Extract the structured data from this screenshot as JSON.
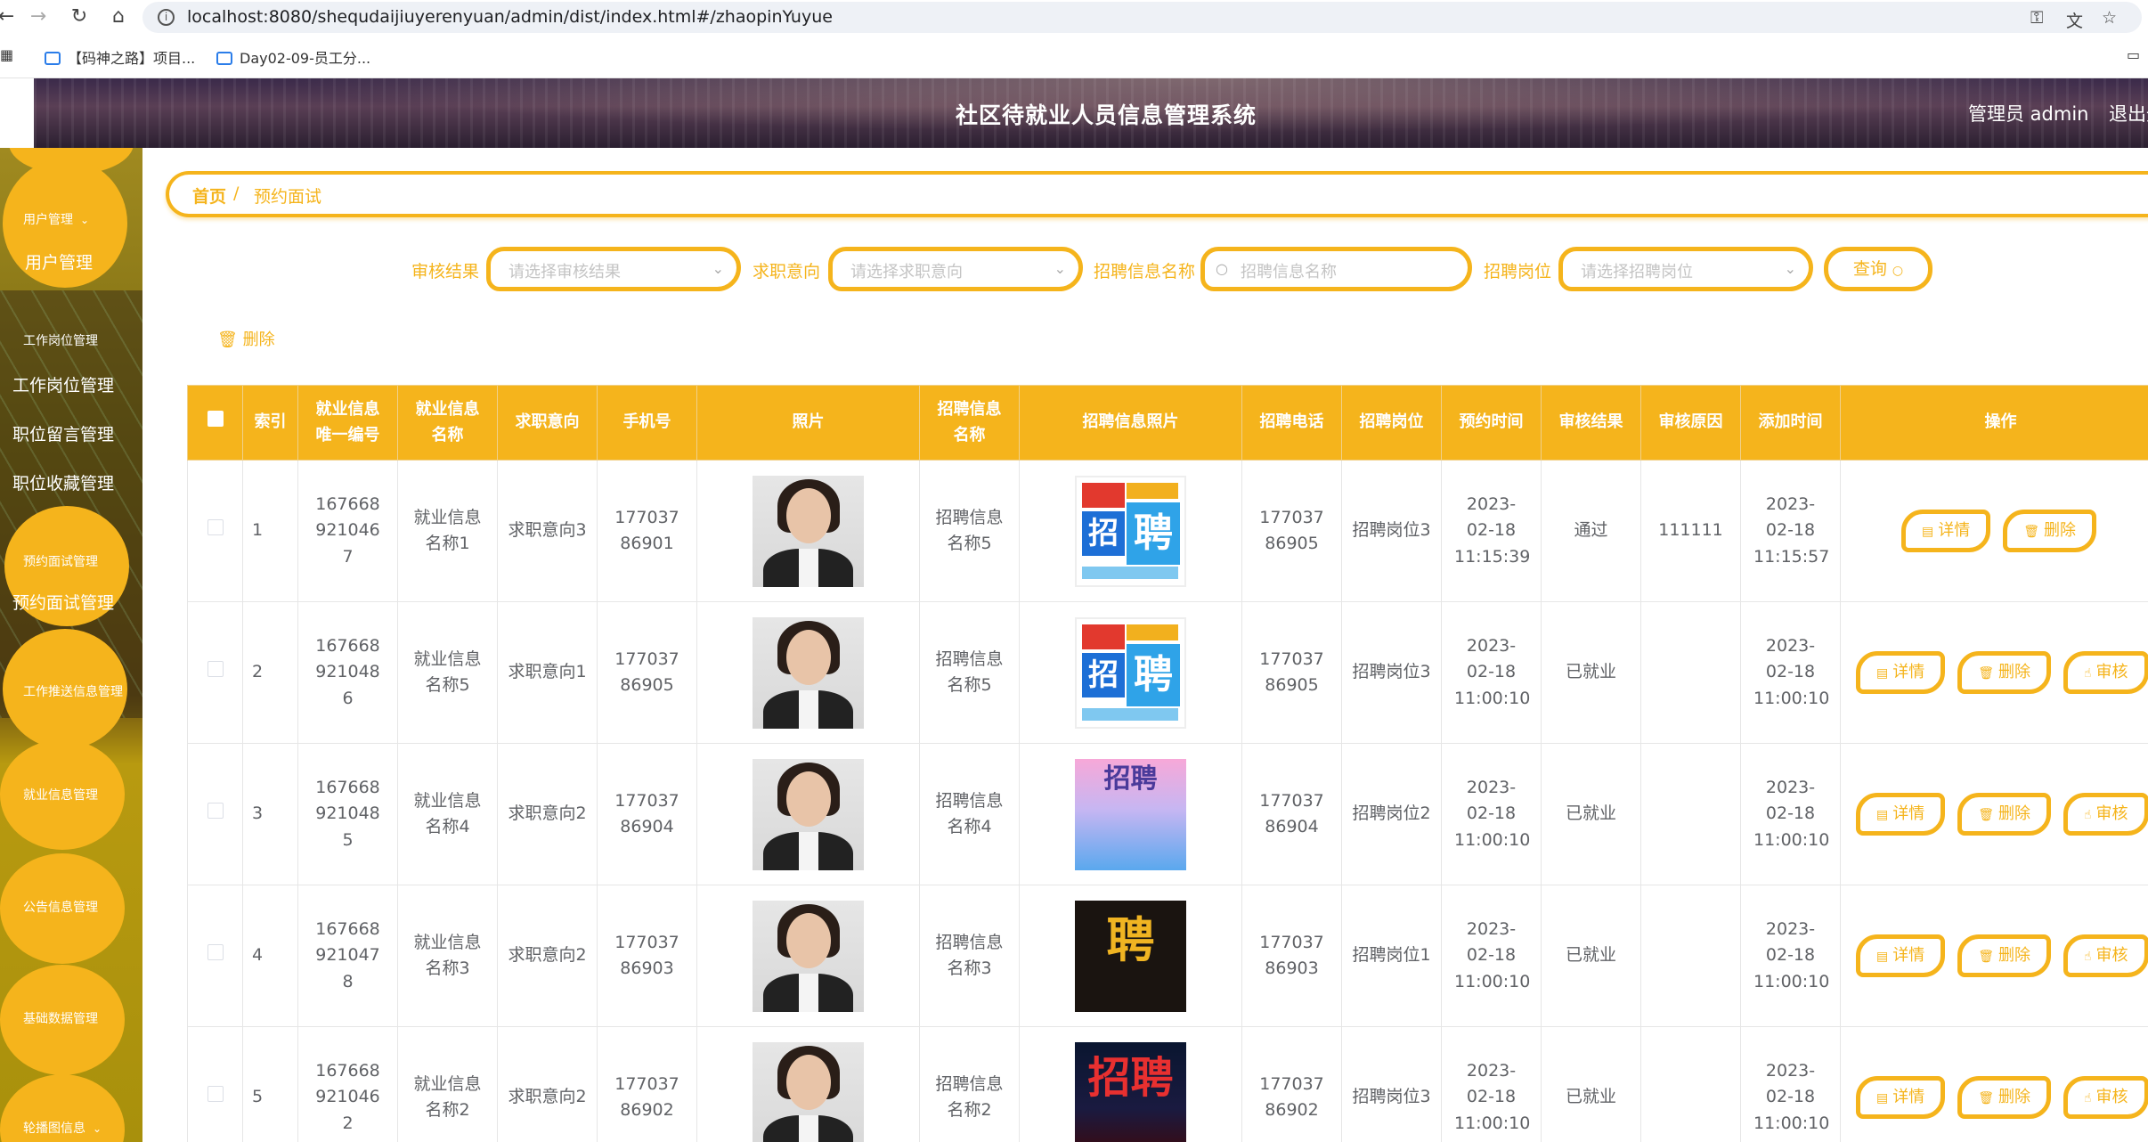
{
  "browser": {
    "url": "localhost:8080/shequdaijiuyerenyuan/admin/dist/index.html#/zhaopinYuyue",
    "bookmarks": [
      "【码神之路】项目...",
      "Day02-09-员工分..."
    ]
  },
  "header": {
    "title": "社区待就业人员信息管理系统",
    "admin": "管理员 admin",
    "logout": "退出登录"
  },
  "sidebar": {
    "items": [
      {
        "label": "用户管理",
        "sub": "用户管理"
      },
      {
        "label": "工作岗位管理",
        "subs": [
          "工作岗位管理",
          "职位留言管理",
          "职位收藏管理"
        ]
      },
      {
        "label": "预约面试管理",
        "sub": "预约面试管理"
      },
      {
        "label": "工作推送信息管理"
      },
      {
        "label": "就业信息管理"
      },
      {
        "label": "公告信息管理"
      },
      {
        "label": "基础数据管理"
      },
      {
        "label": "轮播图信息"
      }
    ]
  },
  "breadcrumb": {
    "home": "首页",
    "separator": "/",
    "current": "预约面试"
  },
  "filters": {
    "audit_label": "审核结果",
    "audit_placeholder": "请选择审核结果",
    "intent_label": "求职意向",
    "intent_placeholder": "请选择求职意向",
    "recruit_name_label": "招聘信息名称",
    "recruit_name_placeholder": "招聘信息名称",
    "post_label": "招聘岗位",
    "post_placeholder": "请选择招聘岗位",
    "query": "查询"
  },
  "actions": {
    "delete": "删除"
  },
  "table": {
    "headers": [
      "索引",
      "就业信息唯一编号",
      "就业信息名称",
      "求职意向",
      "手机号",
      "照片",
      "招聘信息名称",
      "招聘信息照片",
      "招聘电话",
      "招聘岗位",
      "预约时间",
      "审核结果",
      "审核原因",
      "添加时间",
      "操作"
    ],
    "ops": {
      "detail": "详情",
      "delete": "删除",
      "audit": "审核"
    },
    "rows": [
      {
        "index": "1",
        "code": "1676689210467",
        "name": "就业信息名称1",
        "intent": "求职意向3",
        "phone": "17703786901",
        "recruit_name": "招聘信息名称5",
        "recruit_phone": "17703786905",
        "post": "招聘岗位3",
        "appoint_time": "2023-02-18 11:15:39",
        "audit": "通过",
        "reason": "111111",
        "add_time": "2023-02-18 11:15:57",
        "poster": "poster-a",
        "poster_text": "招聘",
        "show_audit": false
      },
      {
        "index": "2",
        "code": "1676689210486",
        "name": "就业信息名称5",
        "intent": "求职意向1",
        "phone": "17703786905",
        "recruit_name": "招聘信息名称5",
        "recruit_phone": "17703786905",
        "post": "招聘岗位3",
        "appoint_time": "2023-02-18 11:00:10",
        "audit": "已就业",
        "reason": "",
        "add_time": "2023-02-18 11:00:10",
        "poster": "poster-a",
        "poster_text": "招聘",
        "show_audit": true
      },
      {
        "index": "3",
        "code": "1676689210485",
        "name": "就业信息名称4",
        "intent": "求职意向2",
        "phone": "17703786904",
        "recruit_name": "招聘信息名称4",
        "recruit_phone": "17703786904",
        "post": "招聘岗位2",
        "appoint_time": "2023-02-18 11:00:10",
        "audit": "已就业",
        "reason": "",
        "add_time": "2023-02-18 11:00:10",
        "poster": "poster-b",
        "poster_text": "招聘",
        "show_audit": true
      },
      {
        "index": "4",
        "code": "1676689210478",
        "name": "就业信息名称3",
        "intent": "求职意向2",
        "phone": "17703786903",
        "recruit_name": "招聘信息名称3",
        "recruit_phone": "17703786903",
        "post": "招聘岗位1",
        "appoint_time": "2023-02-18 11:00:10",
        "audit": "已就业",
        "reason": "",
        "add_time": "2023-02-18 11:00:10",
        "poster": "poster-c",
        "poster_text": "聘",
        "show_audit": true
      },
      {
        "index": "5",
        "code": "1676689210462",
        "name": "就业信息名称2",
        "intent": "求职意向2",
        "phone": "17703786902",
        "recruit_name": "招聘信息名称2",
        "recruit_phone": "17703786902",
        "post": "招聘岗位3",
        "appoint_time": "2023-02-18 11:00:10",
        "audit": "已就业",
        "reason": "",
        "add_time": "2023-02-18 11:00:10",
        "poster": "poster-d",
        "poster_text": "招聘",
        "show_audit": true
      }
    ]
  },
  "colors": {
    "accent": "#f5b41c",
    "text": "#606266"
  },
  "icons": [
    "back-arrow-icon",
    "forward-arrow-icon",
    "reload-icon",
    "home-icon",
    "info-icon",
    "key-icon",
    "translate-icon",
    "star-icon",
    "apps-icon",
    "folder-icon",
    "trash-icon",
    "search-icon",
    "chevron-down-icon",
    "document-icon",
    "hand-icon"
  ]
}
